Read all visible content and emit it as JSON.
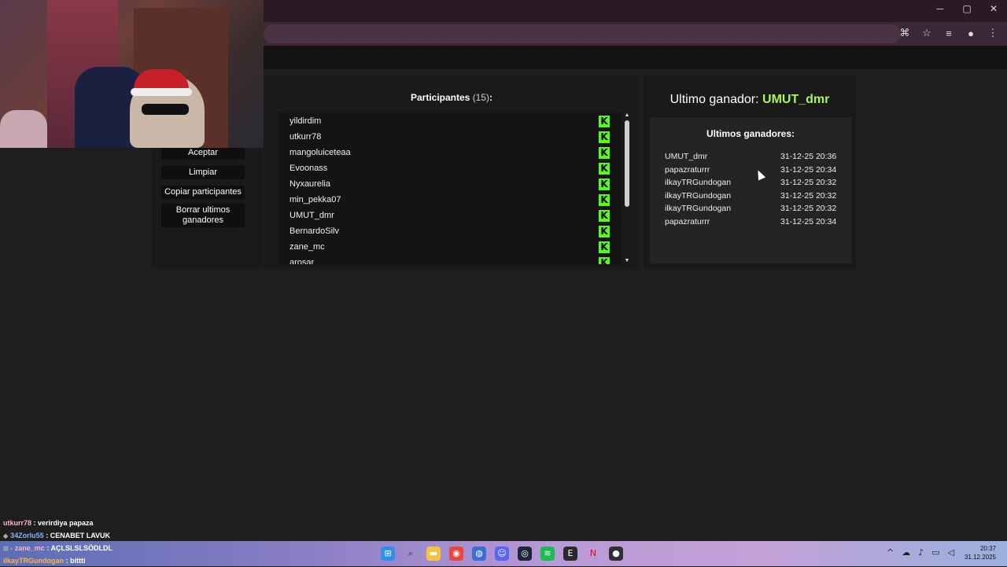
{
  "window_controls": {
    "minimize": "─",
    "maximize": "▢",
    "close": "✕"
  },
  "toolbar": {
    "translate_icon": "⌘",
    "star_icon": "☆",
    "playlist_icon": "≡",
    "menu_icon": "⋮"
  },
  "sidebar": {
    "buttons": [
      "Aceptar",
      "Limpiar",
      "Copiar participantes",
      "Borrar ultimos ganadores"
    ]
  },
  "participants": {
    "title": "Participantes",
    "count": "(15)",
    "colon": ":",
    "names": [
      "yildirdim",
      "utkurr78",
      "mangoluiceteaa",
      "Evoonass",
      "Nyxaurelia",
      "min_pekka07",
      "UMUT_dmr",
      "BernardoSilv",
      "zane_mc",
      "arosar"
    ],
    "platform_icon_letter": "K",
    "platform_color": "#53fc18"
  },
  "winners": {
    "last_label": "Ultimo ganador:",
    "last_name": "UMUT_dmr",
    "box_title": "Ultimos ganadores:",
    "list": [
      {
        "name": "UMUT_dmr",
        "date": "31-12-25 20:36"
      },
      {
        "name": "papazraturrr",
        "date": "31-12-25 20:34"
      },
      {
        "name": "ilkayTRGundogan",
        "date": "31-12-25 20:32"
      },
      {
        "name": "ilkayTRGundogan",
        "date": "31-12-25 20:32"
      },
      {
        "name": "ilkayTRGundogan",
        "date": "31-12-25 20:32"
      },
      {
        "name": "papazraturrr",
        "date": "31-12-25 20:34"
      }
    ]
  },
  "chat": [
    {
      "user": "utkurr78",
      "msg": ": verirdiya papaza",
      "badge": ""
    },
    {
      "user": "34Zorlu55",
      "msg": ": CENABET LAVUK",
      "badge": "◆"
    },
    {
      "user": "zane_mc",
      "msg": ": AÇLSLSLSÖDLDL",
      "badge": "⊠ ▪"
    },
    {
      "user": "ilkayTRGundogan",
      "msg": ": bittti",
      "badge": ""
    }
  ],
  "taskbar": {
    "icons": [
      "windows-start",
      "search",
      "file-explorer",
      "chrome",
      "edge-alt",
      "discord",
      "steam",
      "spotify",
      "epic-games",
      "netflix",
      "obs"
    ],
    "time": "20:37",
    "date": "31.12.2025"
  }
}
